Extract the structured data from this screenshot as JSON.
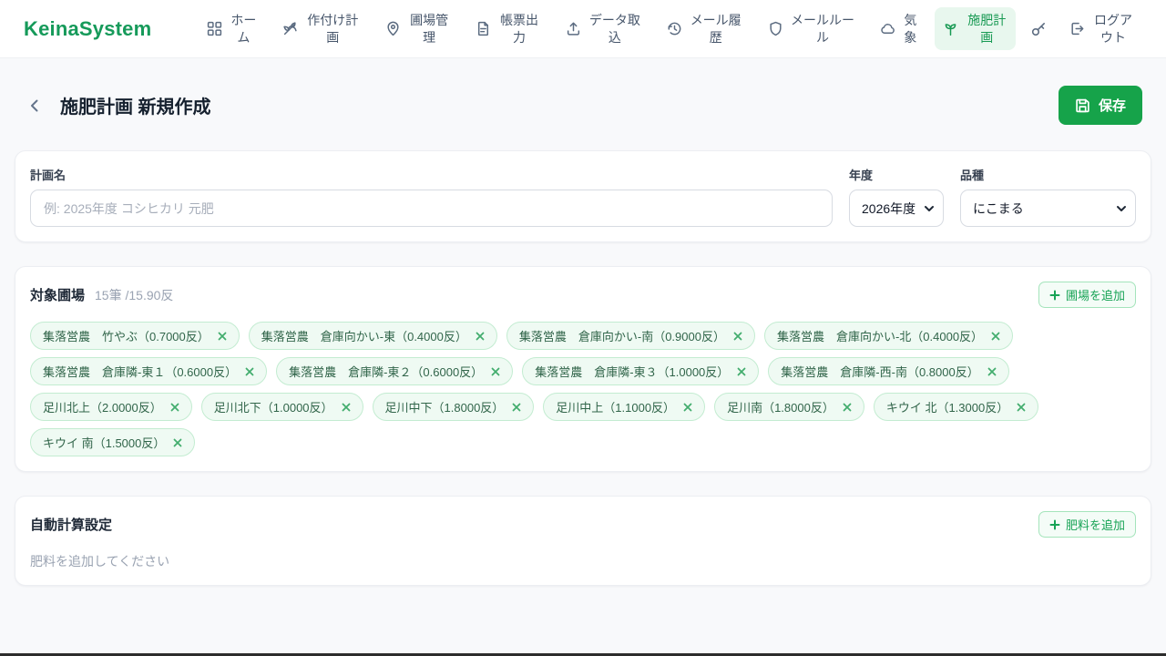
{
  "brand": "KeinaSystem",
  "nav": {
    "items": [
      {
        "label": "ホーム",
        "icon": "grid-icon"
      },
      {
        "label": "作付け計画",
        "icon": "wheat-icon"
      },
      {
        "label": "圃場管理",
        "icon": "map-pin-icon"
      },
      {
        "label": "帳票出力",
        "icon": "document-icon"
      },
      {
        "label": "データ取込",
        "icon": "upload-icon"
      },
      {
        "label": "メール履歴",
        "icon": "history-clock-icon"
      },
      {
        "label": "メールルール",
        "icon": "shield-icon"
      },
      {
        "label": "気象",
        "icon": "cloud-icon"
      },
      {
        "label": "施肥計画",
        "icon": "sprout-icon",
        "active": true
      },
      {
        "label": "ログアウト",
        "icon": "logout-icon"
      }
    ],
    "key_button": {
      "icon": "key-icon"
    }
  },
  "header": {
    "title": "施肥計画 新規作成",
    "save_label": "保存"
  },
  "form": {
    "plan_name_label": "計画名",
    "plan_name_placeholder": "例: 2025年度 コシヒカリ 元肥",
    "plan_name_value": "",
    "year_label": "年度",
    "year_value": "2026年度",
    "variety_label": "品種",
    "variety_value": "にこまる"
  },
  "fields_section": {
    "title": "対象圃場",
    "summary": "15筆 /15.90反",
    "add_button_label": "圃場を追加",
    "tags": [
      {
        "label": "集落営農　竹やぶ（0.7000反）"
      },
      {
        "label": "集落営農　倉庫向かい-東（0.4000反）"
      },
      {
        "label": "集落営農　倉庫向かい-南（0.9000反）"
      },
      {
        "label": "集落営農　倉庫向かい-北（0.4000反）"
      },
      {
        "label": "集落営農　倉庫隣-東１（0.6000反）"
      },
      {
        "label": "集落営農　倉庫隣-東２（0.6000反）"
      },
      {
        "label": "集落営農　倉庫隣-東３（1.0000反）"
      },
      {
        "label": "集落営農　倉庫隣-西-南（0.8000反）"
      },
      {
        "label": "足川北上（2.0000反）"
      },
      {
        "label": "足川北下（1.0000反）"
      },
      {
        "label": "足川中下（1.8000反）"
      },
      {
        "label": "足川中上（1.1000反）"
      },
      {
        "label": "足川南（1.8000反）"
      },
      {
        "label": "キウイ 北（1.3000反）"
      },
      {
        "label": "キウイ 南（1.5000反）"
      }
    ]
  },
  "auto_calc_section": {
    "title": "自動計算設定",
    "add_button_label": "肥料を追加",
    "empty_text": "肥料を追加してください"
  },
  "colors": {
    "brand_green": "#169a5a",
    "primary_button": "#16a34a",
    "active_nav_bg": "#e8f7ee",
    "tag_bg": "#effaf3",
    "tag_border": "#c3ecd1",
    "page_bg": "#f8f9fb"
  }
}
